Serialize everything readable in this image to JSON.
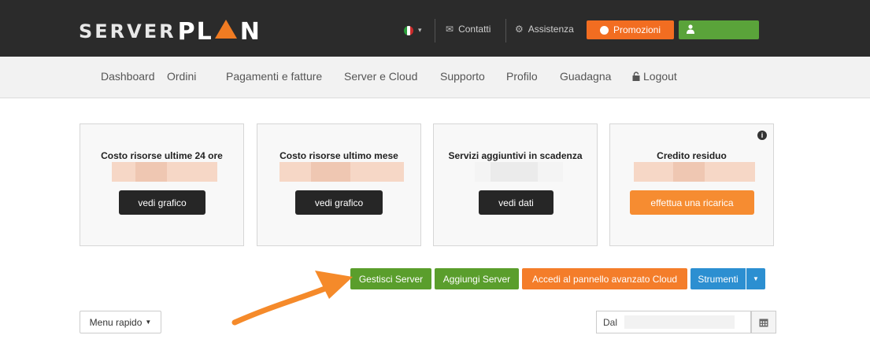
{
  "brand": {
    "server": "SERVER",
    "plan": "PL",
    "plan_end": "N"
  },
  "topbar": {
    "contatti": "Contatti",
    "assistenza": "Assistenza",
    "promozioni": "Promozioni",
    "flag_caret": "▾",
    "icons": {
      "mail": "envelope-icon",
      "gear": "gear-icon",
      "promo": "chat-icon",
      "user": "user-icon"
    },
    "colors": {
      "bar": "#2b2b2b",
      "promo": "#f26d21",
      "user": "#5aa33a"
    }
  },
  "nav": {
    "items": [
      "Dashboard",
      "Ordini",
      "Pagamenti e fatture",
      "Server e Cloud",
      "Supporto",
      "Profilo",
      "Guadagna"
    ],
    "logout": "Logout"
  },
  "cards": [
    {
      "title": "Costo risorse ultime 24 ore",
      "button": "vedi grafico"
    },
    {
      "title": "Costo risorse ultimo mese",
      "button": "vedi grafico"
    },
    {
      "title": "Servizi aggiuntivi in scadenza",
      "button": "vedi dati"
    },
    {
      "title": "Credito residuo",
      "button": "effettua una ricarica"
    }
  ],
  "actions": {
    "gestisci": "Gestisci Server",
    "aggiungi": "Aggiungi Server",
    "cloud": "Accedi al pannello avanzato Cloud",
    "strumenti": "Strumenti",
    "colors": {
      "green": "#5a9e2c",
      "orange": "#f47d2a",
      "blue": "#2c8fd1"
    }
  },
  "menu_rapido": "Menu rapido",
  "date_filter": {
    "label": "Dal"
  },
  "accent_arrow": "#f58a2a"
}
